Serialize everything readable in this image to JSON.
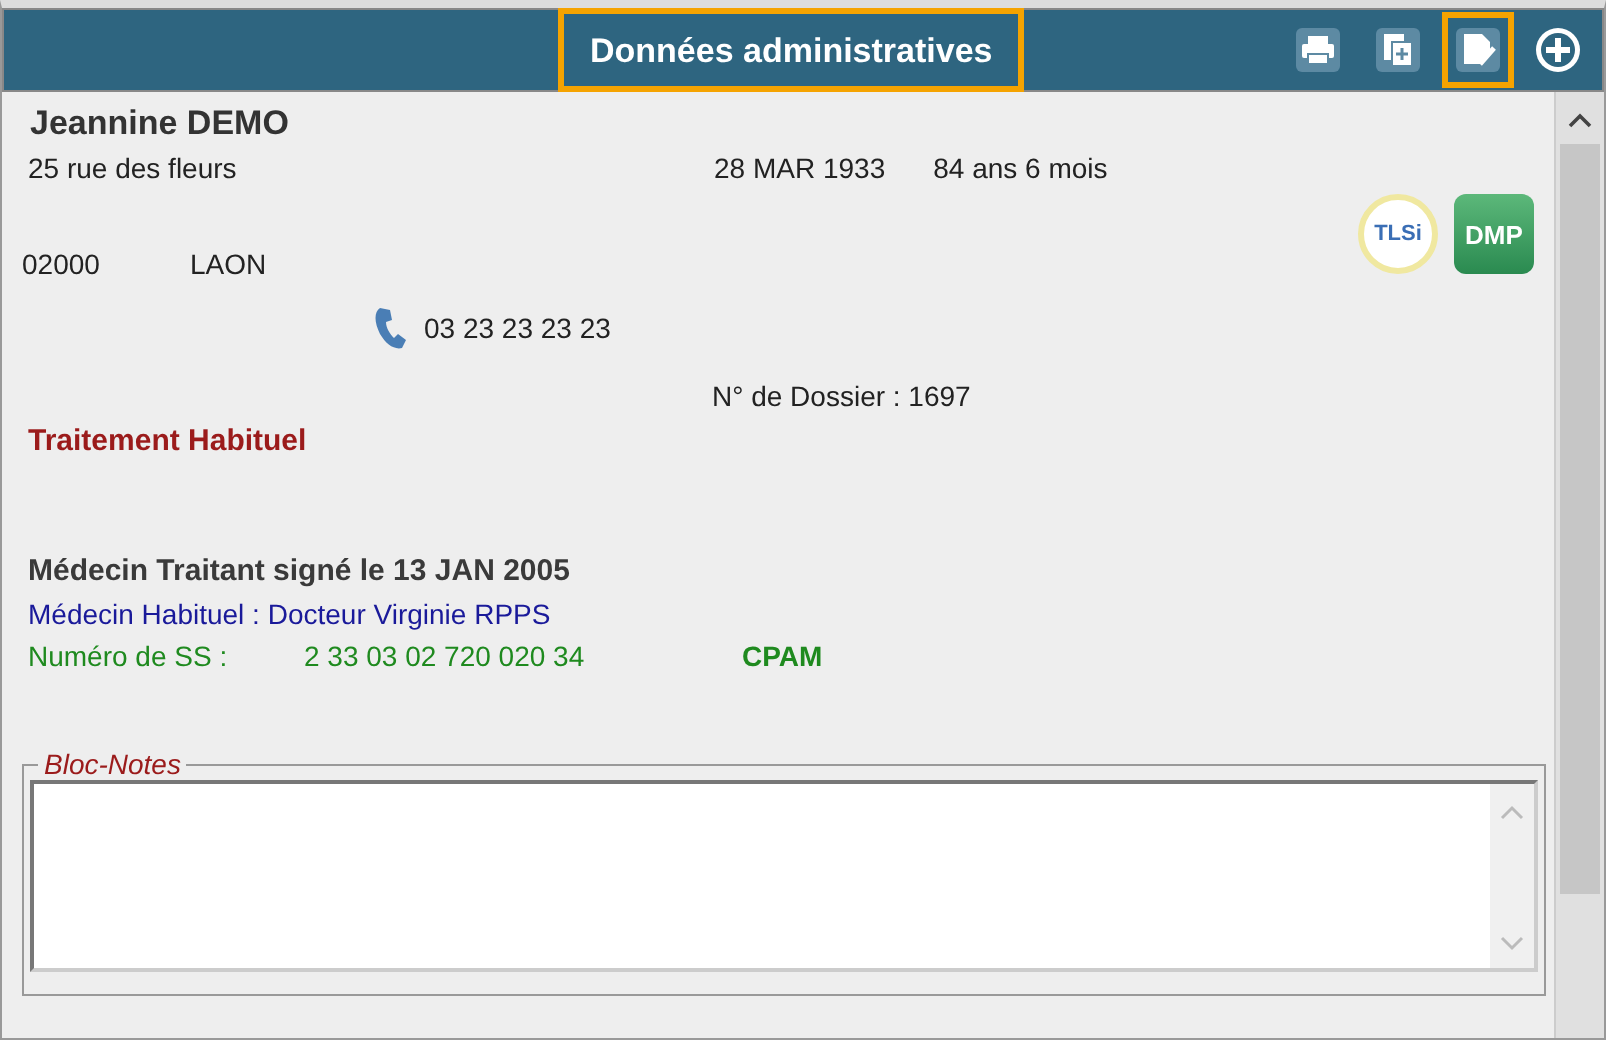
{
  "header": {
    "title": "Données administratives",
    "title_highlighted": true,
    "tools": [
      {
        "kind": "print",
        "highlighted": false
      },
      {
        "kind": "copy",
        "highlighted": false
      },
      {
        "kind": "edit",
        "highlighted": true
      },
      {
        "kind": "add",
        "highlighted": false
      }
    ]
  },
  "patient": {
    "name": "Jeannine DEMO",
    "address": "25 rue des fleurs",
    "birth_date": "28 MAR 1933",
    "age": "84 ans 6 mois",
    "postcode": "02000",
    "city": "LAON",
    "phone": "03 23 23 23 23",
    "file_number": "N° de Dossier : 1697"
  },
  "logos": [
    {
      "label": "TLSi",
      "kind": "round"
    },
    {
      "label": "DMP",
      "kind": "square"
    }
  ],
  "treatment_label": "Traitement Habituel",
  "doctor_signed": "Médecin Traitant signé le 13 JAN 2005",
  "doctor_usual": "Médecin Habituel : Docteur Virginie RPPS",
  "ss_label": "Numéro de SS :",
  "ss_number": "2 33 03 02 720 020 34",
  "fund": "CPAM",
  "notes": {
    "legend": "Bloc-Notes"
  }
}
